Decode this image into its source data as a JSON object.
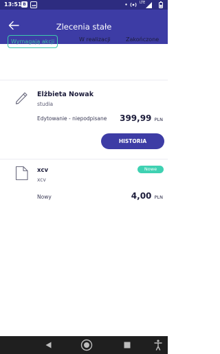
{
  "status_bar": {
    "time": "13:51",
    "icons": [
      "b-icon",
      "image-icon",
      "dot-icon",
      "hotspot-icon",
      "lte-signal-icon",
      "battery-icon"
    ],
    "lte_label": "LTE"
  },
  "app_bar": {
    "title": "Zlecenia stałe",
    "back_icon": "arrow-left-icon",
    "color": "#3d3ca5"
  },
  "tabs": [
    {
      "label": "Wymagają akcji",
      "active": true
    },
    {
      "label": "W realizacji",
      "active": false
    },
    {
      "label": "Zakończone",
      "active": false
    }
  ],
  "orders": [
    {
      "icon": "pencil-icon",
      "name": "Elżbieta Nowak",
      "description": "studia",
      "status": "Edytowanie - niepodpisane",
      "amount": "399,99",
      "currency": "PLN",
      "button_label": "HISTORIA"
    },
    {
      "icon": "document-icon",
      "name": "xcv",
      "description": "xcv",
      "status": "Nowy",
      "amount": "4,00",
      "currency": "PLN",
      "badge": "Nowe"
    }
  ],
  "nav_bar": {
    "icons": [
      "back-triangle-icon",
      "home-circle-icon",
      "recents-square-icon",
      "accessibility-icon"
    ]
  },
  "colors": {
    "primary": "#3d3ca5",
    "accent": "#3fc8ad"
  }
}
